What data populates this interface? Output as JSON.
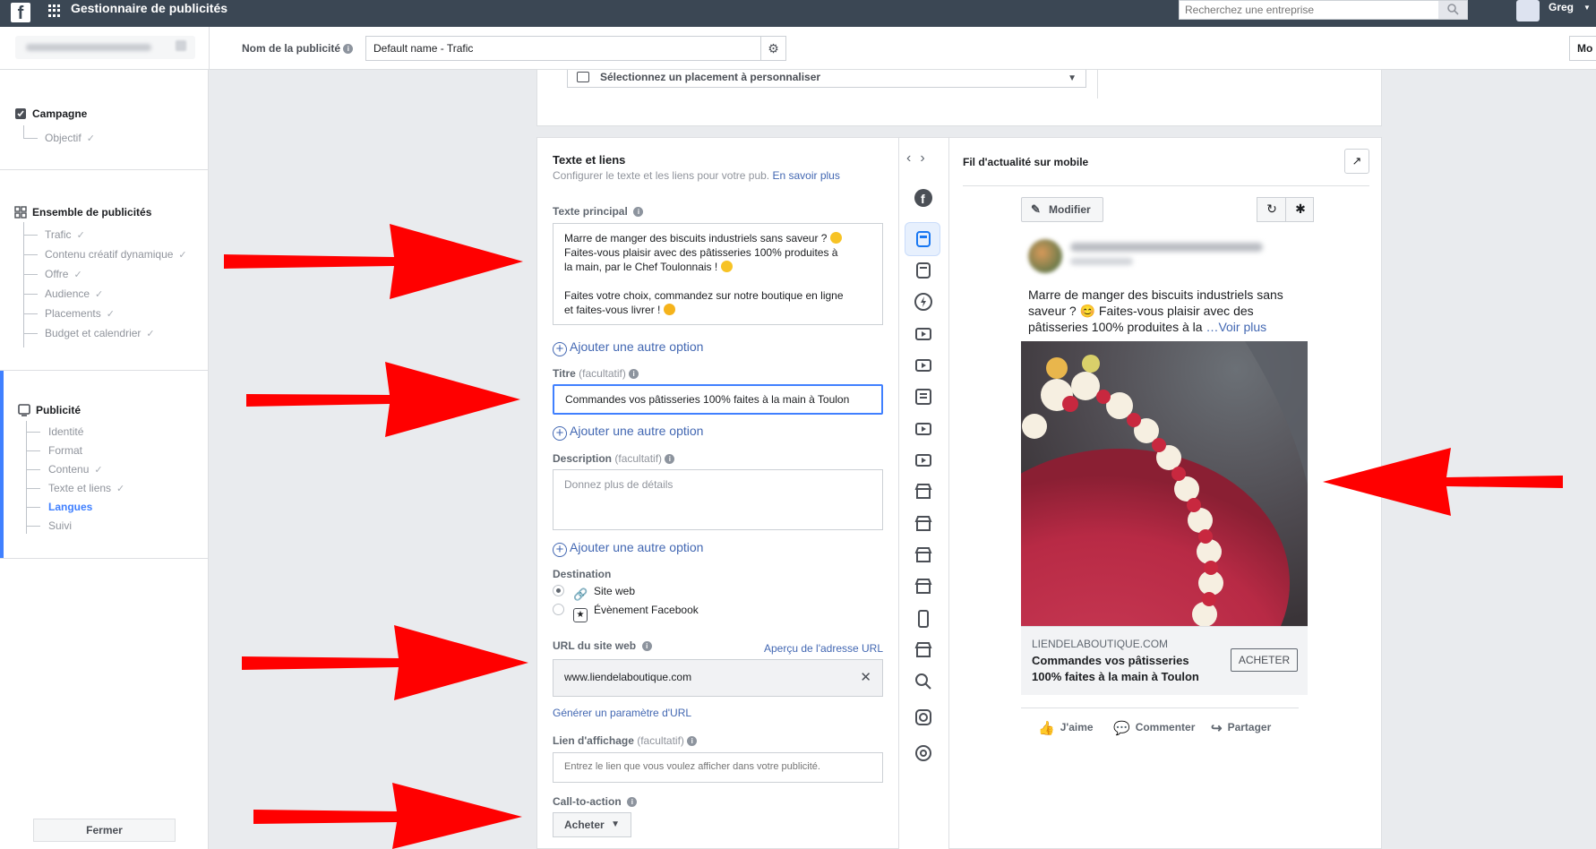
{
  "topbar": {
    "app_title": "Gestionnaire de publicités",
    "search_placeholder": "Recherchez une entreprise",
    "user_name": "Greg"
  },
  "subheader": {
    "ad_name_label": "Nom de la publicité",
    "ad_name_value": "Default name - Trafic",
    "right_button": "Mo"
  },
  "sidebar": {
    "campaign": {
      "title": "Campagne",
      "items": [
        {
          "label": "Objectif",
          "done": true
        }
      ]
    },
    "adset": {
      "title": "Ensemble de publicités",
      "items": [
        {
          "label": "Trafic",
          "done": true
        },
        {
          "label": "Contenu créatif dynamique",
          "done": true
        },
        {
          "label": "Offre",
          "done": true
        },
        {
          "label": "Audience",
          "done": true
        },
        {
          "label": "Placements",
          "done": true
        },
        {
          "label": "Budget et calendrier",
          "done": true
        }
      ]
    },
    "ad": {
      "title": "Publicité",
      "items": [
        {
          "label": "Identité",
          "done": false
        },
        {
          "label": "Format",
          "done": false
        },
        {
          "label": "Contenu",
          "done": true
        },
        {
          "label": "Texte et liens",
          "done": true
        },
        {
          "label": "Langues",
          "done": false,
          "active": true
        },
        {
          "label": "Suivi",
          "done": false
        }
      ]
    },
    "close_label": "Fermer"
  },
  "placement": {
    "select_label": "Sélectionnez un placement à personnaliser"
  },
  "form": {
    "title": "Texte et liens",
    "subtitle": "Configurer le texte et les liens pour votre pub.",
    "learn_more": "En savoir plus",
    "primary_text_label": "Texte principal",
    "primary_text_lines": [
      "Marre de manger des biscuits industriels sans saveur ?",
      "Faites-vous plaisir avec des pâtisseries 100% produites à",
      "la main, par le Chef Toulonnais !",
      "",
      "Faites votre choix, commandez sur notre boutique en ligne",
      "et faites-vous livrer !"
    ],
    "add_option": "Ajouter une autre option",
    "headline_label": "Titre",
    "optional": "(facultatif)",
    "headline_value": "Commandes vos pâtisseries 100% faites à la main à Toulon",
    "description_label": "Description",
    "description_placeholder": "Donnez plus de détails",
    "destination_label": "Destination",
    "destination_options": [
      "Site web",
      "Évènement Facebook"
    ],
    "url_label": "URL du site web",
    "url_preview_link": "Aperçu de l'adresse URL",
    "url_value": "www.liendelaboutique.com",
    "url_param_link": "Générer un paramètre d'URL",
    "display_link_label": "Lien d'affichage",
    "display_link_placeholder": "Entrez le lien que vous voulez afficher dans votre publicité.",
    "cta_label": "Call-to-action",
    "cta_value": "Acheter"
  },
  "preview": {
    "title": "Fil d'actualité sur mobile",
    "modify_label": "Modifier",
    "post_text": "Marre de manger des biscuits industriels sans saveur ? 😊 Faites-vous plaisir avec des pâtisseries 100% produites à la",
    "see_more": "…Voir plus",
    "link_domain": "LIENDELABOUTIQUE.COM",
    "link_headline": "Commandes vos pâtisseries 100% faites à la main à Toulon",
    "cta": "ACHETER",
    "actions": {
      "like": "J'aime",
      "comment": "Commenter",
      "share": "Partager"
    }
  },
  "colors": {
    "topbar": "#3b4754",
    "link_blue": "#4267b2",
    "focus_blue": "#4080ff",
    "annotation_red": "#ff0000"
  }
}
